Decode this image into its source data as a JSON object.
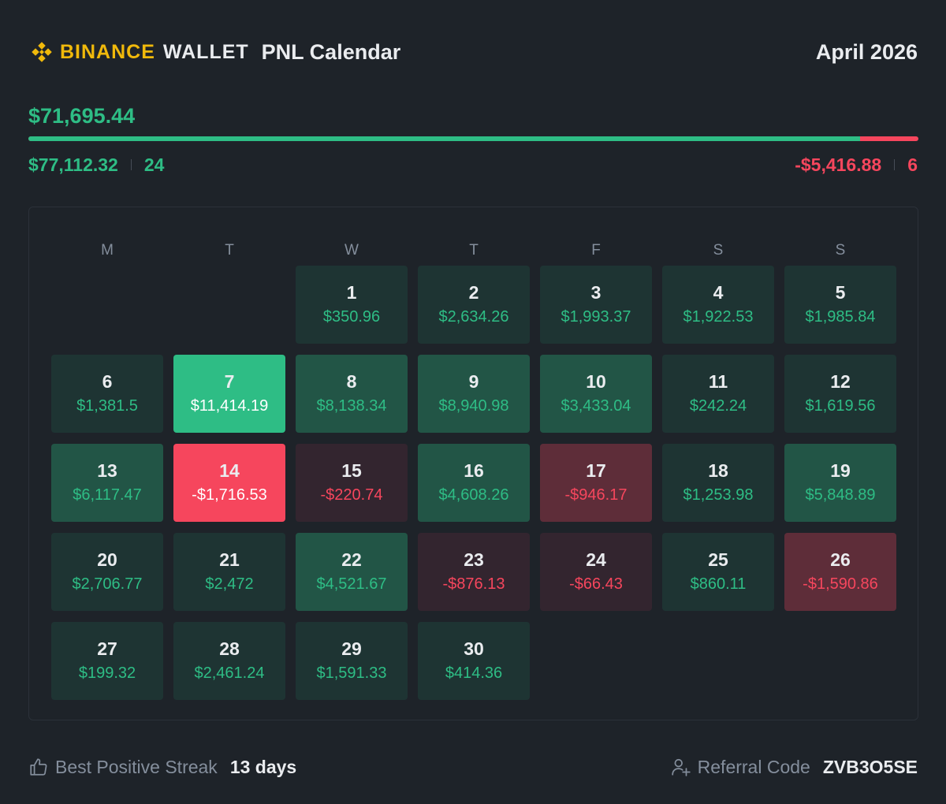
{
  "header": {
    "brand": "BINANCE",
    "brand_sub": "WALLET",
    "title": "PNL Calendar",
    "month": "April 2026"
  },
  "summary": {
    "total": "$71,695.44",
    "positive_total": "$77,112.32",
    "positive_days": "24",
    "negative_total": "-$5,416.88",
    "negative_days": "6",
    "positive_share": 0.9344
  },
  "weekdays": [
    "M",
    "T",
    "W",
    "T",
    "F",
    "S",
    "S"
  ],
  "days": [
    {
      "day": "1",
      "value": "$350.96",
      "level": "pos-1"
    },
    {
      "day": "2",
      "value": "$2,634.26",
      "level": "pos-1"
    },
    {
      "day": "3",
      "value": "$1,993.37",
      "level": "pos-1"
    },
    {
      "day": "4",
      "value": "$1,922.53",
      "level": "pos-1"
    },
    {
      "day": "5",
      "value": "$1,985.84",
      "level": "pos-1"
    },
    {
      "day": "6",
      "value": "$1,381.5",
      "level": "pos-1"
    },
    {
      "day": "7",
      "value": "$11,414.19",
      "level": "pos-3"
    },
    {
      "day": "8",
      "value": "$8,138.34",
      "level": "pos-2"
    },
    {
      "day": "9",
      "value": "$8,940.98",
      "level": "pos-2"
    },
    {
      "day": "10",
      "value": "$3,433.04",
      "level": "pos-2"
    },
    {
      "day": "11",
      "value": "$242.24",
      "level": "pos-1"
    },
    {
      "day": "12",
      "value": "$1,619.56",
      "level": "pos-1"
    },
    {
      "day": "13",
      "value": "$6,117.47",
      "level": "pos-2"
    },
    {
      "day": "14",
      "value": "-$1,716.53",
      "level": "neg-3"
    },
    {
      "day": "15",
      "value": "-$220.74",
      "level": "neg-1"
    },
    {
      "day": "16",
      "value": "$4,608.26",
      "level": "pos-2"
    },
    {
      "day": "17",
      "value": "-$946.17",
      "level": "neg-2"
    },
    {
      "day": "18",
      "value": "$1,253.98",
      "level": "pos-1"
    },
    {
      "day": "19",
      "value": "$5,848.89",
      "level": "pos-2"
    },
    {
      "day": "20",
      "value": "$2,706.77",
      "level": "pos-1"
    },
    {
      "day": "21",
      "value": "$2,472",
      "level": "pos-1"
    },
    {
      "day": "22",
      "value": "$4,521.67",
      "level": "pos-2"
    },
    {
      "day": "23",
      "value": "-$876.13",
      "level": "neg-1"
    },
    {
      "day": "24",
      "value": "-$66.43",
      "level": "neg-1"
    },
    {
      "day": "25",
      "value": "$860.11",
      "level": "pos-1"
    },
    {
      "day": "26",
      "value": "-$1,590.86",
      "level": "neg-2"
    },
    {
      "day": "27",
      "value": "$199.32",
      "level": "pos-1"
    },
    {
      "day": "28",
      "value": "$2,461.24",
      "level": "pos-1"
    },
    {
      "day": "29",
      "value": "$1,591.33",
      "level": "pos-1"
    },
    {
      "day": "30",
      "value": "$414.36",
      "level": "pos-1"
    }
  ],
  "first_weekday_index": 2,
  "footer": {
    "streak_label": "Best Positive Streak",
    "streak_value": "13 days",
    "referral_label": "Referral Code",
    "referral_code": "ZVB3O5SE"
  },
  "icons": {
    "logo": "binance-diamond-icon",
    "streak": "thumbs-up-icon",
    "referral": "add-user-icon"
  },
  "colors": {
    "brand": "#f0b90b",
    "positive": "#2ebd85",
    "negative": "#f6465d",
    "background": "#1e2329"
  }
}
